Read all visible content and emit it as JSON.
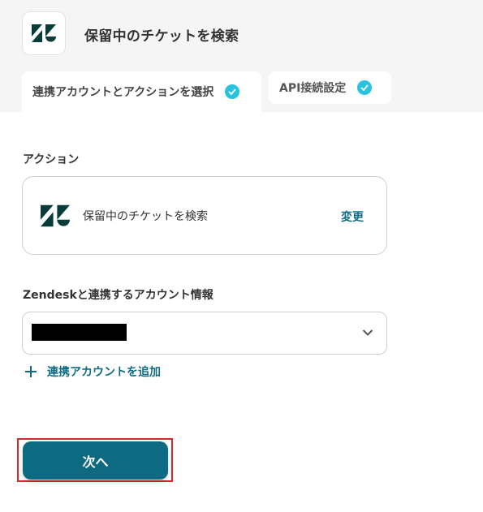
{
  "header": {
    "title": "保留中のチケットを検索",
    "logo_icon": "zendesk-logo-icon"
  },
  "tabs": [
    {
      "label": "連携アカウントとアクションを選択",
      "completed": true
    },
    {
      "label": "API接続設定",
      "completed": true
    }
  ],
  "action_section": {
    "label": "アクション",
    "action_name": "保留中のチケットを検索",
    "change_label": "変更"
  },
  "account_section": {
    "label": "Zendeskと連携するアカウント情報",
    "selected_value_redacted": true,
    "add_account_label": "連携アカウントを追加"
  },
  "footer": {
    "next_label": "次へ"
  },
  "colors": {
    "accent": "#0e6a81",
    "check": "#27c3df",
    "highlight": "#d6262e"
  }
}
